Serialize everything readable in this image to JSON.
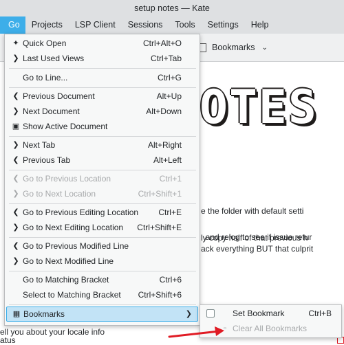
{
  "window": {
    "title": "setup notes — Kate"
  },
  "menubar": {
    "items": [
      "Go",
      "Projects",
      "LSP Client",
      "Sessions",
      "Tools",
      "Settings",
      "Help"
    ]
  },
  "toolbar": {
    "bookmarks_label": "Bookmarks"
  },
  "editor": {
    "big_heading": "OTES",
    "lines": [
      "e the folder with default setti",
      "and relog to see if issue retur",
      "ly copy half of that previous h",
      "ack everything BUT that culprit",
      "ell you about your locale info",
      "atus"
    ],
    "link_word": "relog"
  },
  "go_menu": {
    "items": [
      {
        "label": "Quick Open",
        "shortcut": "Ctrl+Alt+O",
        "icon": "spark-icon"
      },
      {
        "label": "Last Used Views",
        "shortcut": "Ctrl+Tab",
        "icon": "chevron-right-icon"
      },
      {
        "label": "Go to Line...",
        "shortcut": "Ctrl+G",
        "icon": ""
      },
      {
        "label": "Previous Document",
        "shortcut": "Alt+Up",
        "icon": "chevron-left-icon"
      },
      {
        "label": "Next Document",
        "shortcut": "Alt+Down",
        "icon": "chevron-right-icon"
      },
      {
        "label": "Show Active Document",
        "shortcut": "",
        "icon": "locate-icon"
      },
      {
        "label": "Next Tab",
        "shortcut": "Alt+Right",
        "icon": "chevron-right-icon"
      },
      {
        "label": "Previous Tab",
        "shortcut": "Alt+Left",
        "icon": "chevron-left-icon"
      },
      {
        "label": "Go to Previous Location",
        "shortcut": "Ctrl+1",
        "icon": "chevron-left-icon",
        "disabled": true
      },
      {
        "label": "Go to Next Location",
        "shortcut": "Ctrl+Shift+1",
        "icon": "chevron-right-icon",
        "disabled": true
      },
      {
        "label": "Go to Previous Editing Location",
        "shortcut": "Ctrl+E",
        "icon": "chevron-left-icon"
      },
      {
        "label": "Go to Next Editing Location",
        "shortcut": "Ctrl+Shift+E",
        "icon": "chevron-right-icon"
      },
      {
        "label": "Go to Previous Modified Line",
        "shortcut": "",
        "icon": "chevron-left-icon"
      },
      {
        "label": "Go to Next Modified Line",
        "shortcut": "",
        "icon": "chevron-right-icon"
      },
      {
        "label": "Go to Matching Bracket",
        "shortcut": "Ctrl+6",
        "icon": ""
      },
      {
        "label": "Select to Matching Bracket",
        "shortcut": "Ctrl+Shift+6",
        "icon": ""
      },
      {
        "label": "Bookmarks",
        "shortcut": "",
        "icon": "bookmark-icon"
      }
    ]
  },
  "bookmarks_submenu": {
    "items": [
      {
        "label": "Set Bookmark",
        "shortcut": "Ctrl+B"
      },
      {
        "label": "Clear All Bookmarks",
        "shortcut": "",
        "disabled": true
      }
    ]
  },
  "colors": {
    "accent": "#3daee9",
    "annotation": "#e01b24"
  }
}
